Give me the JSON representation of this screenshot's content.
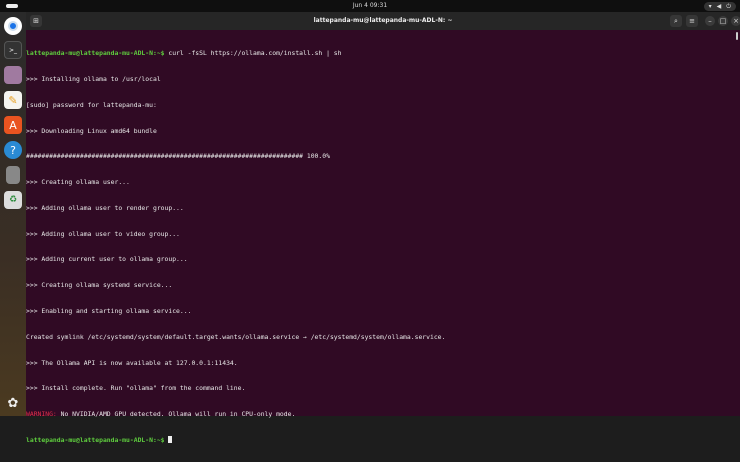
{
  "topbar": {
    "clock": "Jun 4  09:31",
    "tray": [
      "wifi-icon",
      "volume-icon",
      "power-icon"
    ]
  },
  "dock": [
    "chrome",
    "terminal",
    "files",
    "text-editor",
    "app-center",
    "help",
    "drive",
    "trash",
    "show-apps"
  ],
  "window": {
    "title": "lattepanda-mu@lattepanda-mu-ADL-N: ~"
  },
  "terminal": {
    "prompt": "lattepanda-mu@lattepanda-mu-ADL-N:~$ ",
    "command": "curl -fsSL https://ollama.com/install.sh | sh",
    "lines": [
      ">>> Installing ollama to /usr/local",
      "[sudo] password for lattepanda-mu:",
      ">>> Downloading Linux amd64 bundle",
      "######################################################################## 100.0%",
      ">>> Creating ollama user...",
      ">>> Adding ollama user to render group...",
      ">>> Adding ollama user to video group...",
      ">>> Adding current user to ollama group...",
      ">>> Creating ollama systemd service...",
      ">>> Enabling and starting ollama service...",
      "Created symlink /etc/systemd/system/default.target.wants/ollama.service → /etc/systemd/system/ollama.service.",
      ">>> The Ollama API is now available at 127.0.0.1:11434.",
      ">>> Install complete. Run \"ollama\" from the command line."
    ],
    "warning_label": "WARNING:",
    "warning_text": " No NVIDIA/AMD GPU detected. Ollama will run in CPU-only mode."
  }
}
